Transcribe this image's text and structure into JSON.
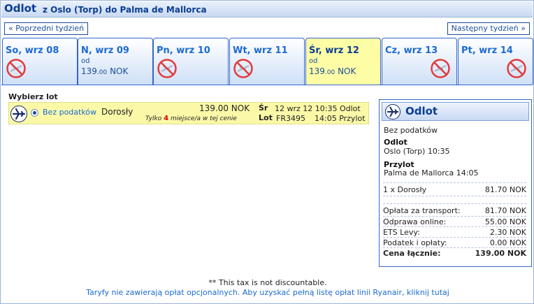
{
  "header": {
    "title": "Odlot",
    "route": "z Oslo (Torp) do Palma de Mallorca"
  },
  "nav": {
    "prev_label": "« Poprzedni tydzień",
    "next_label": "Następny tydzień »"
  },
  "tabs": [
    {
      "day": "So, wrz 08",
      "available": false
    },
    {
      "day": "N, wrz 09",
      "from_label": "od",
      "price": "139",
      "decimals": ".00",
      "currency": "NOK",
      "available": true
    },
    {
      "day": "Pn, wrz 10",
      "available": false
    },
    {
      "day": "Wt, wrz 11",
      "available": false
    },
    {
      "day": "Śr, wrz 12",
      "from_label": "od",
      "price": "139",
      "decimals": ".00",
      "currency": "NOK",
      "available": true,
      "active": true
    },
    {
      "day": "Cz, wrz 13",
      "available": false
    },
    {
      "day": "Pt, wrz 14",
      "available": false
    }
  ],
  "flight_select": {
    "title": "Wybierz lot",
    "fare_name": "Bez podatków",
    "pax_type": "Dorosły",
    "price": "139.00 NOK",
    "seats_prefix": "Tylko",
    "seats_count": "4",
    "seats_suffix": "miejsce/a w tej cenie",
    "day": "Śr",
    "departure": "12 wrz 12 10:35 Odlot",
    "lot_label": "Lot",
    "flight_number": "FR3495",
    "arrival": "14:05 Przylot"
  },
  "summary": {
    "title": "Odlot",
    "fare_name": "Bez podatków",
    "departure_label": "Odlot",
    "departure_value": "Oslo (Torp) 10:35",
    "arrival_label": "Przylot",
    "arrival_value": "Palma de Mallorca 14:05",
    "pax": {
      "label": "1 x Dorosły",
      "value": "81.70 NOK"
    },
    "fees": [
      {
        "label": "Opłata za transport:",
        "value": "81.70 NOK"
      },
      {
        "label": "Odprawa online:",
        "value": "55.00 NOK"
      },
      {
        "label": "ETS Levy:",
        "value": "2.30 NOK"
      },
      {
        "label": "Podatek i opłaty:",
        "value": "0.00 NOK"
      }
    ],
    "total": {
      "label": "Cena łącznie:",
      "value": "139.00 NOK"
    }
  },
  "footer": {
    "tax_note": "** This tax is not discountable.",
    "fees_link": "Taryfy nie zawierają opłat opcjonalnych. Aby uzyskać pełną listę opłat linii Ryanair, kliknij tutaj"
  },
  "colors": {
    "accent": "#0b3d91",
    "active_tab": "#fdfda6",
    "no_flight": "#e23b3b",
    "seats_highlight": "#d10000"
  },
  "icons": {
    "plane": "plane-icon",
    "no_flight": "no-flight-icon"
  }
}
